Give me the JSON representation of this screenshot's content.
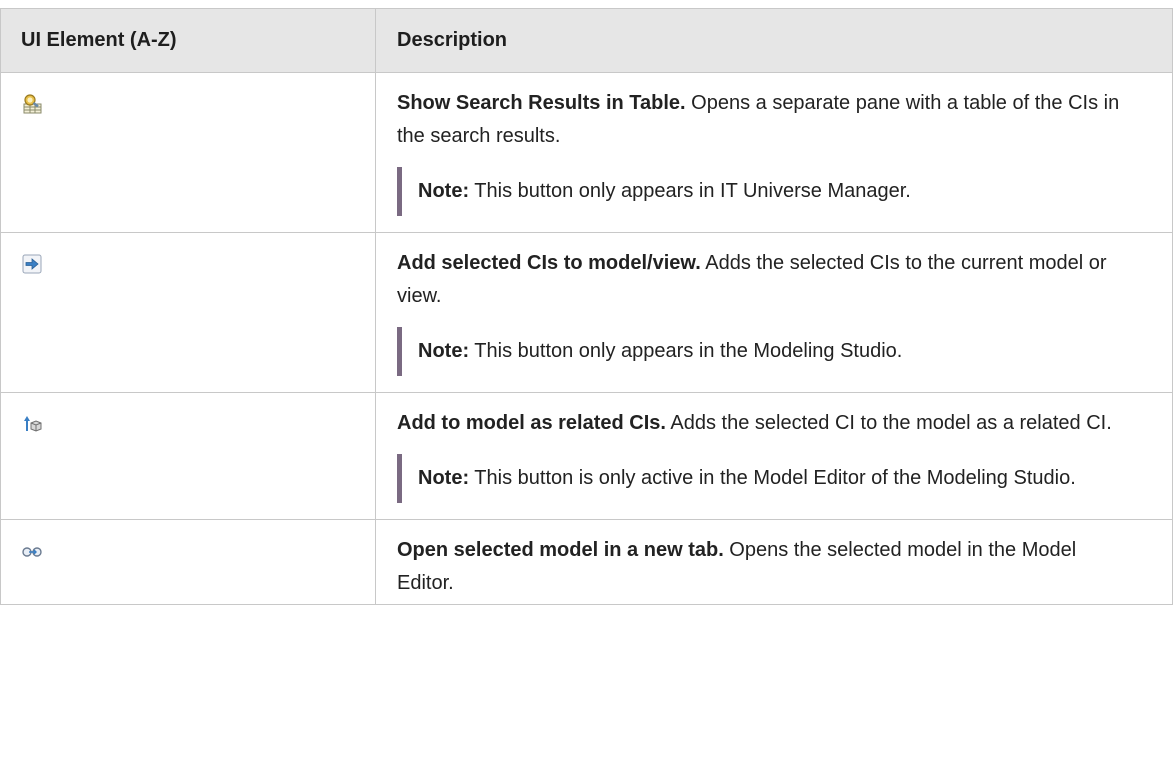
{
  "table": {
    "headers": {
      "element": "UI Element (A-Z)",
      "description": "Description"
    },
    "rows": [
      {
        "icon": "search-results-table-icon",
        "title": "Show Search Results in Table.",
        "text": " Opens a separate pane with a table of the CIs in the search results.",
        "note_label": "Note:",
        "note_text": "  This button only appears in IT Universe Manager."
      },
      {
        "icon": "add-to-model-arrow-icon",
        "title": "Add selected CIs to model/view.",
        "text": " Adds the selected CIs to the current model or view.",
        "note_label": "Note:",
        "note_text": "  This button only appears in the Modeling Studio."
      },
      {
        "icon": "add-related-ci-icon",
        "title": "Add to model as related CIs.",
        "text": " Adds the selected CI to the model as a related CI.",
        "note_label": "Note:",
        "note_text": "  This button is only active in the Model Editor of the Modeling Studio."
      },
      {
        "icon": "open-model-new-tab-icon",
        "title": "Open selected model in a new tab.",
        "text": " Opens the selected model in the Model Editor."
      }
    ]
  },
  "colors": {
    "header_bg": "#e6e6e6",
    "border": "#c8c8c8",
    "note_bar": "#7a6a82"
  }
}
